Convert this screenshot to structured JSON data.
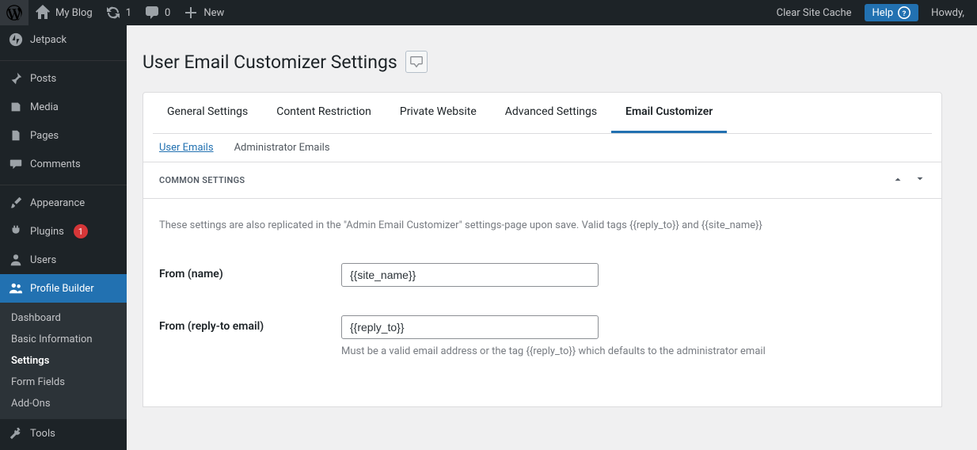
{
  "adminbar": {
    "site_name": "My Blog",
    "updates_count": "1",
    "comments_count": "0",
    "new_label": "New",
    "clear_cache": "Clear Site Cache",
    "help": "Help",
    "howdy": "Howdy,"
  },
  "sidebar": {
    "jetpack": "Jetpack",
    "posts": "Posts",
    "media": "Media",
    "pages": "Pages",
    "comments": "Comments",
    "appearance": "Appearance",
    "plugins": "Plugins",
    "plugins_badge": "1",
    "users": "Users",
    "profile_builder": "Profile Builder",
    "tools": "Tools",
    "sub": {
      "dashboard": "Dashboard",
      "basic_info": "Basic Information",
      "settings": "Settings",
      "form_fields": "Form Fields",
      "addons": "Add-Ons"
    }
  },
  "page": {
    "title": "User Email Customizer Settings"
  },
  "tabs": {
    "general": "General Settings",
    "content_restriction": "Content Restriction",
    "private_website": "Private Website",
    "advanced": "Advanced Settings",
    "email_customizer": "Email Customizer"
  },
  "subtabs": {
    "user_emails": "User Emails",
    "admin_emails": "Administrator Emails"
  },
  "panel": {
    "title": "Common Settings",
    "desc": "These settings are also replicated in the \"Admin Email Customizer\" settings-page upon save. Valid tags {{reply_to}} and {{site_name}}",
    "from_name_label": "From (name)",
    "from_name_value": "{{site_name}}",
    "from_reply_label": "From (reply-to email)",
    "from_reply_value": "{{reply_to}}",
    "reply_help": "Must be a valid email address or the tag {{reply_to}} which defaults to the administrator email"
  }
}
